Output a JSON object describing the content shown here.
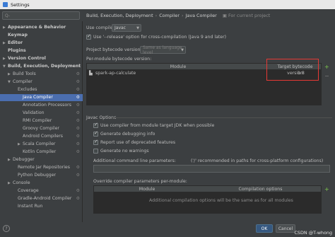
{
  "window": {
    "title": "Settings"
  },
  "search": {
    "placeholder": "Q-"
  },
  "sidebar": {
    "items": [
      {
        "label": "Appearance & Behavior",
        "arrow": "▶",
        "bold": true
      },
      {
        "label": "Keymap",
        "arrow": "",
        "bold": true
      },
      {
        "label": "Editor",
        "arrow": "▶",
        "bold": true
      },
      {
        "label": "Plugins",
        "arrow": "",
        "bold": true
      },
      {
        "label": "Version Control",
        "arrow": "▶",
        "bold": true
      },
      {
        "label": "Build, Execution, Deployment",
        "arrow": "▼",
        "bold": true
      },
      {
        "label": "Build Tools",
        "arrow": "▶"
      },
      {
        "label": "Compiler",
        "arrow": "▼"
      },
      {
        "label": "Excludes",
        "arrow": ""
      },
      {
        "label": "Java Compiler",
        "arrow": "",
        "selected": true
      },
      {
        "label": "Annotation Processors",
        "arrow": ""
      },
      {
        "label": "Validation",
        "arrow": ""
      },
      {
        "label": "RMI Compiler",
        "arrow": ""
      },
      {
        "label": "Groovy Compiler",
        "arrow": ""
      },
      {
        "label": "Android Compilers",
        "arrow": ""
      },
      {
        "label": "Scala Compiler",
        "arrow": "▶"
      },
      {
        "label": "Kotlin Compiler",
        "arrow": ""
      },
      {
        "label": "Debugger",
        "arrow": "▶"
      },
      {
        "label": "Remote Jar Repositories",
        "arrow": ""
      },
      {
        "label": "Python Debugger",
        "arrow": ""
      },
      {
        "label": "Console",
        "arrow": "▶"
      },
      {
        "label": "Coverage",
        "arrow": ""
      },
      {
        "label": "Gradle-Android Compiler",
        "arrow": ""
      },
      {
        "label": "Instant Run",
        "arrow": ""
      }
    ]
  },
  "breadcrumb": {
    "part1": "Build, Execution, Deployment",
    "sep": "›",
    "part2": "Compiler",
    "part3": "Java Compiler",
    "project_note": "For current project"
  },
  "main": {
    "use_compiler_label": "Use compiler:",
    "use_compiler_value": "Javac",
    "release_option_label": "Use '--release' option for cross-compilation (Java 9 and later)",
    "project_bytecode_label": "Project bytecode version:",
    "project_bytecode_value": "Same as language level",
    "per_module_label": "Per-module bytecode version:",
    "module_table": {
      "headers": [
        "Module",
        "Target bytecode version"
      ],
      "rows": [
        {
          "module": "spark-ap-calculate",
          "version": "1.8"
        }
      ]
    },
    "javac_options_label": "Javac Options",
    "options": [
      {
        "label": "Use compiler from module target JDK when possible",
        "checked": true
      },
      {
        "label": "Generate debugging info",
        "checked": true
      },
      {
        "label": "Report use of deprecated features",
        "checked": true
      },
      {
        "label": "Generate no warnings",
        "checked": false
      }
    ],
    "additional_params_label": "Additional command line parameters:",
    "additional_params_hint": "('/' recommended in paths for cross-platform configurations)",
    "override_label": "Override compiler parameters per-module:",
    "override_table": {
      "headers": [
        "Module",
        "Compilation options"
      ],
      "empty_text": "Additional compilation options will be the same as for all modules"
    }
  },
  "buttons": {
    "ok": "OK",
    "cancel": "Cancel",
    "help": "?"
  },
  "watermark": "CSDN @T-whong",
  "icons": {
    "add": "+",
    "remove": "−",
    "gear": "⚙"
  },
  "colors": {
    "selection": "#4b6eaf",
    "highlight_box": "#e53935",
    "primary_button": "#365880"
  }
}
